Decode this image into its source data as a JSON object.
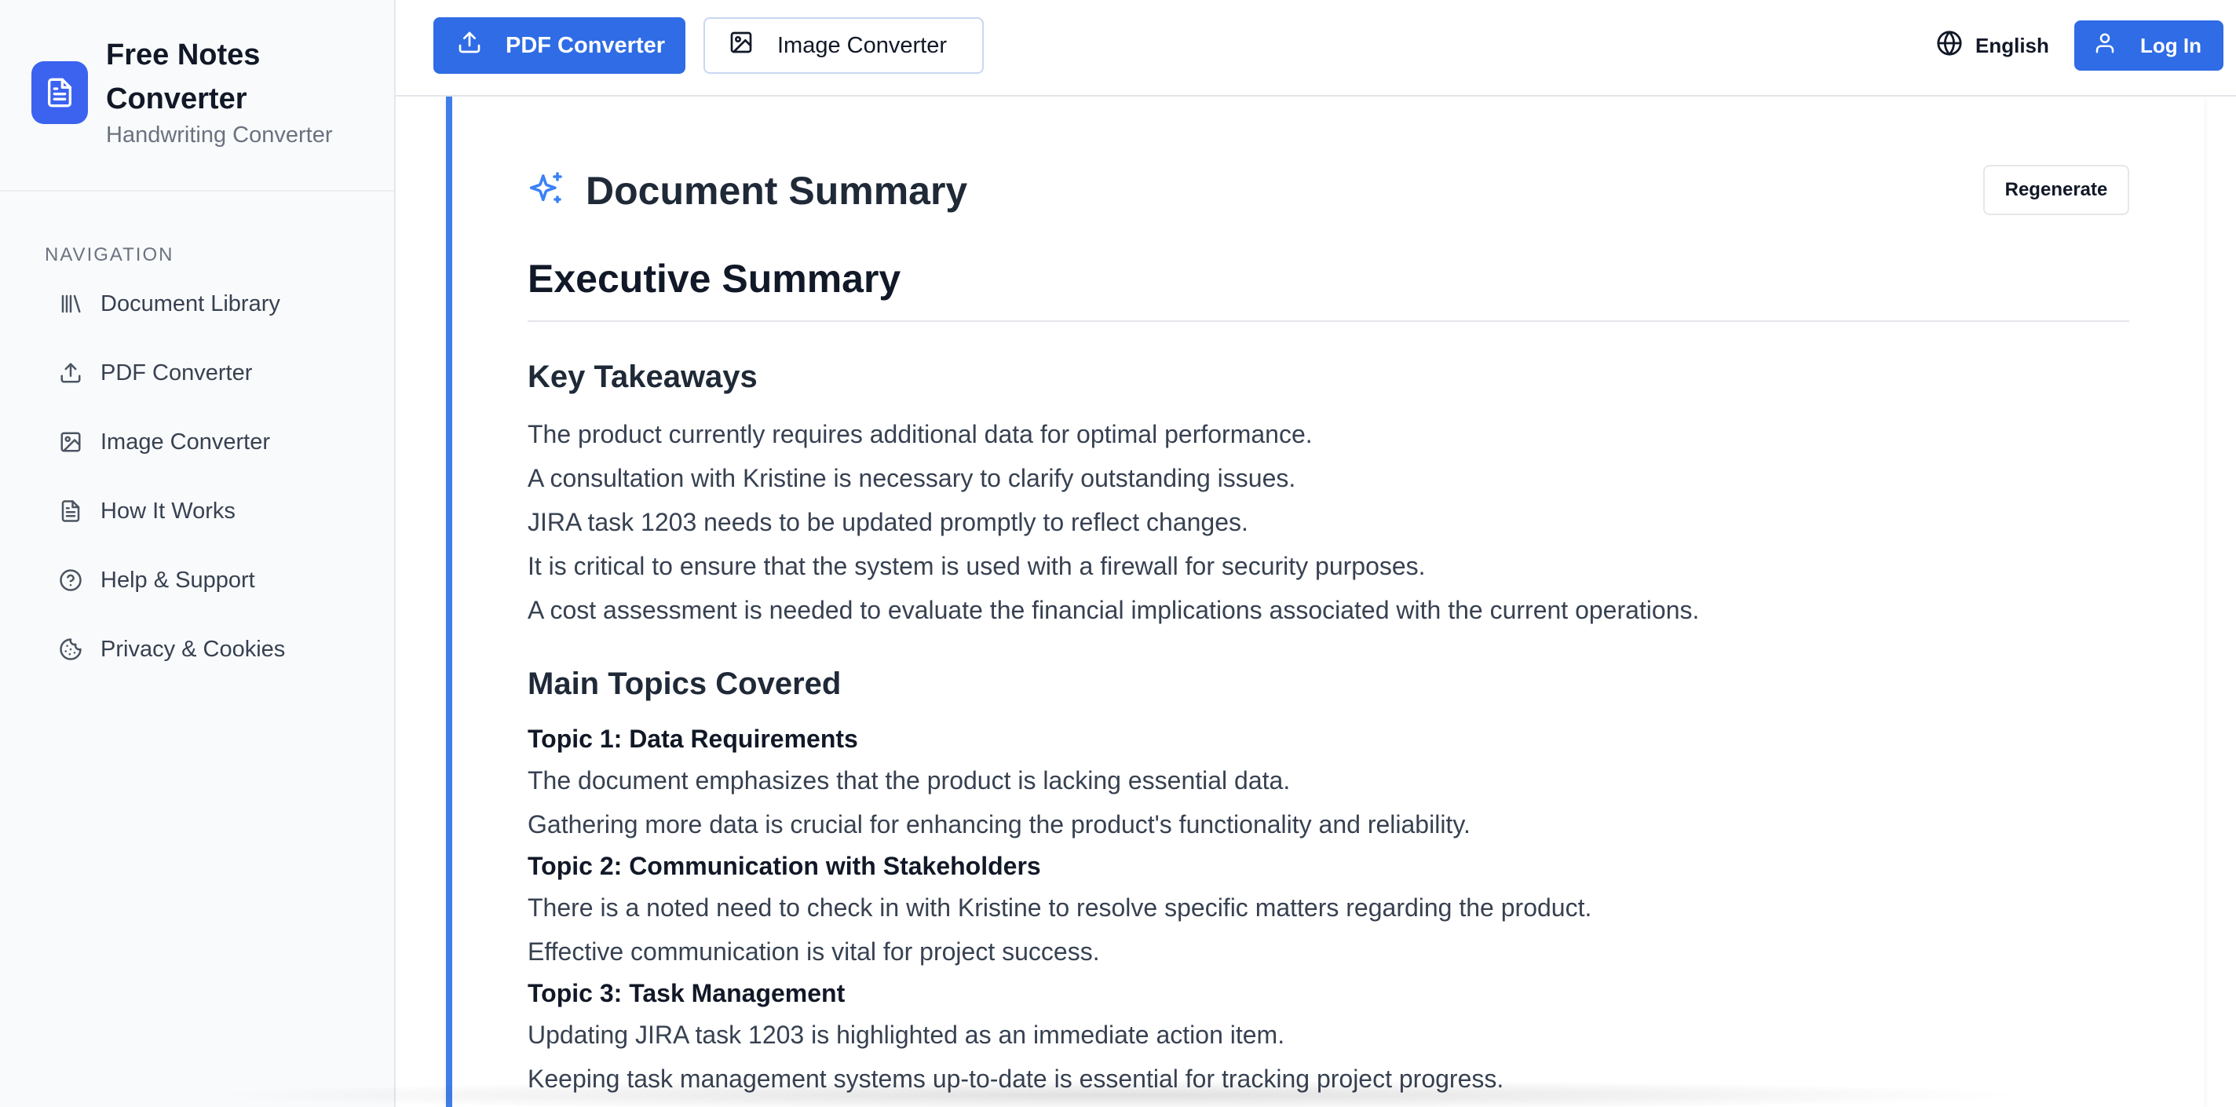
{
  "brand": {
    "title": "Free Notes Converter",
    "subtitle": "Handwriting Converter"
  },
  "sidebar": {
    "heading": "NAVIGATION",
    "items": [
      {
        "label": "Document Library",
        "icon": "library-icon"
      },
      {
        "label": "PDF Converter",
        "icon": "upload-icon"
      },
      {
        "label": "Image Converter",
        "icon": "image-icon"
      },
      {
        "label": "How It Works",
        "icon": "document-icon"
      },
      {
        "label": "Help & Support",
        "icon": "help-circle-icon"
      },
      {
        "label": "Privacy & Cookies",
        "icon": "cookie-icon"
      }
    ]
  },
  "topbar": {
    "pdf_converter": "PDF Converter",
    "image_converter": "Image Converter",
    "language": "English",
    "login": "Log In"
  },
  "summary": {
    "header": "Document Summary",
    "regenerate": "Regenerate",
    "executive": "Executive Summary",
    "key_takeaways_heading": "Key Takeaways",
    "takeaways": [
      "The product currently requires additional data for optimal performance.",
      "A consultation with Kristine is necessary to clarify outstanding issues.",
      "JIRA task 1203 needs to be updated promptly to reflect changes.",
      "It is critical to ensure that the system is used with a firewall for security purposes.",
      "A cost assessment is needed to evaluate the financial implications associated with the current operations."
    ],
    "topics_heading": "Main Topics Covered",
    "topics": [
      {
        "title": "Topic 1: Data Requirements",
        "lines": [
          "The document emphasizes that the product is lacking essential data.",
          "Gathering more data is crucial for enhancing the product's functionality and reliability."
        ]
      },
      {
        "title": "Topic 2: Communication with Stakeholders",
        "lines": [
          "There is a noted need to check in with Kristine to resolve specific matters regarding the product.",
          "Effective communication is vital for project success."
        ]
      },
      {
        "title": "Topic 3: Task Management",
        "lines": [
          "Updating JIRA task 1203 is highlighted as an immediate action item.",
          "Keeping task management systems up-to-date is essential for tracking project progress."
        ]
      }
    ]
  },
  "colors": {
    "primary": "#2f6ce5",
    "logo": "#3b63f0",
    "card_accent": "#3f7ee8",
    "sparkle": "#3b82f6"
  }
}
